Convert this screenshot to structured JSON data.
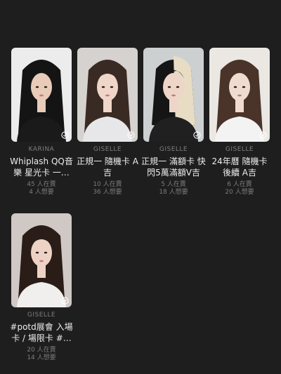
{
  "listings": [
    {
      "member": "KARINA",
      "title": "Whiplash QQ音樂 星光卡 一…",
      "selling": "45 人在賣",
      "wanting": "4 人想要",
      "bg": "#ececec",
      "skin": "#e8cbb8",
      "hair": "#141414",
      "top": "#1a1a1a",
      "hair_style": "long"
    },
    {
      "member": "GISELLE",
      "title": "正規一 隨機卡 A吉",
      "selling": "10 人在賣",
      "wanting": "36 人想要",
      "bg": "#d6d2cf",
      "skin": "#efd6c8",
      "hair": "#3a2a24",
      "top": "#e7e7e9",
      "hair_style": "bangs"
    },
    {
      "member": "GISELLE",
      "title": "正規一 滿額卡 快閃5萬滿額V吉",
      "selling": "5 人在賣",
      "wanting": "18 人想要",
      "bg": "#cdd0d1",
      "skin": "#edd5c8",
      "hair": "#151515",
      "top": "#202020",
      "hair_style": "split"
    },
    {
      "member": "GISELLE",
      "title": "24年曆 隨機卡 後續 A吉",
      "selling": "6 人在賣",
      "wanting": "20 人想要",
      "bg": "#ebe7e3",
      "skin": "#f0dccf",
      "hair": "#4a3328",
      "top": "#f3f3f3",
      "hair_style": "long"
    },
    {
      "member": "GISELLE",
      "title": "#potd展會 入場卡 / 場限卡 #…",
      "selling": "20 人在賣",
      "wanting": "14 人想要",
      "bg": "#cfc8c4",
      "skin": "#edd3c5",
      "hair": "#2a1d18",
      "top": "#f0efee",
      "hair_style": "bangs"
    }
  ],
  "icons": {
    "check": "check-circle-icon"
  }
}
